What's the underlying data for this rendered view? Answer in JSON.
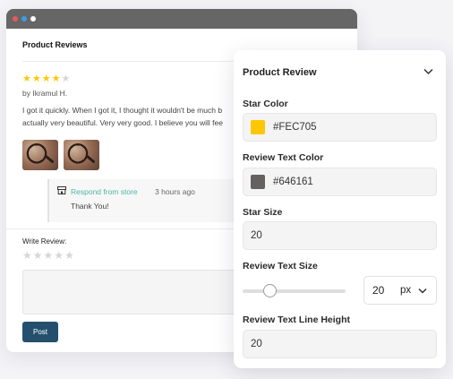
{
  "colors": {
    "window_bar": "#666666",
    "dot_red": "#e35a5a",
    "dot_blue": "#3c9be8",
    "dot_white": "#ffffff",
    "star_filled": "#FEC705",
    "star_empty": "#d6d6d6",
    "post_button": "#24506e",
    "store_accent": "#4bb5a6",
    "review_text": "#646161"
  },
  "preview": {
    "title": "Product Reviews",
    "rating": 4,
    "rating_max": 5,
    "author": "by Ikramul H.",
    "review_line1": "I got it quickly. When I got it, I thought it wouldn't be much b",
    "review_line2": "actually very beautiful. Very very good. I believe you will fee",
    "thumbnails": [
      "review-photo-1",
      "review-photo-2"
    ],
    "reply": {
      "store_name": "Respond from store",
      "time": "3 hours ago",
      "message": "Thank You!"
    },
    "write_label": "Write Review:",
    "post_label": "Post"
  },
  "panel": {
    "title": "Product Review",
    "star_color_label": "Star Color",
    "star_color_value": "#FEC705",
    "review_text_color_label": "Review Text Color",
    "review_text_color_value": "#646161",
    "star_size_label": "Star Size",
    "star_size_value": "20",
    "review_text_size_label": "Review Text Size",
    "review_text_size_value": "20",
    "review_text_size_unit": "px",
    "review_text_size_slider_fraction": 0.25,
    "line_height_label": "Review Text Line Height",
    "line_height_value": "20"
  }
}
